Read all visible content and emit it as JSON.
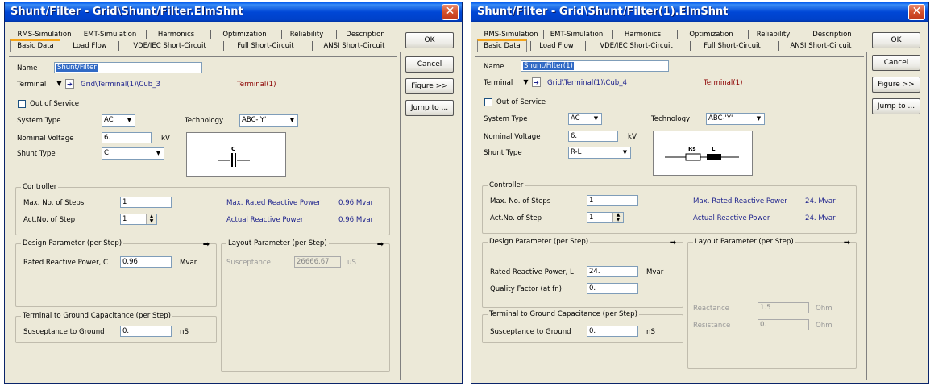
{
  "buttons": {
    "ok": "OK",
    "cancel": "Cancel",
    "figure": "Figure >>",
    "jump": "Jump to ..."
  },
  "tabs_row1": [
    "RMS-Simulation",
    "EMT-Simulation",
    "Harmonics",
    "Optimization",
    "Reliability",
    "Description"
  ],
  "tabs_row2": [
    "Basic Data",
    "Load Flow",
    "VDE/IEC Short-Circuit",
    "Full Short-Circuit",
    "ANSI Short-Circuit"
  ],
  "labels": {
    "name": "Name",
    "terminal": "Terminal",
    "out_of_service": "Out of Service",
    "system_type": "System Type",
    "technology": "Technology",
    "nominal_voltage": "Nominal Voltage",
    "kv": "kV",
    "shunt_type": "Shunt Type",
    "controller": "Controller",
    "max_steps": "Max. No. of Steps",
    "act_step": "Act.No. of Step",
    "max_rated_q": "Max. Rated Reactive Power",
    "actual_q": "Actual Reactive Power",
    "design": "Design Parameter (per Step)",
    "layout": "Layout Parameter (per Step)",
    "mvar": "Mvar",
    "t2g": "Terminal to Ground Capacitance (per Step)",
    "susc_ground": "Susceptance to Ground",
    "ns": "nS",
    "susceptance": "Susceptance",
    "us": "uS",
    "quality": "Quality Factor (at fn)",
    "reactance": "Reactance",
    "resistance": "Resistance",
    "ohm": "Ohm"
  },
  "left": {
    "title": "Shunt/Filter - Grid\\Shunt/Filter.ElmShnt",
    "name": "Shunt/Filter",
    "terminal_path": "Grid\\Terminal(1)\\Cub_3",
    "terminal_ref": "Terminal(1)",
    "system_type": "AC",
    "technology": "ABC-'Y'",
    "nominal_voltage": "6.",
    "shunt_type": "C",
    "diagram_label": "C",
    "max_steps": "1",
    "act_step": "1",
    "max_rated_q_value": "0.96 Mvar",
    "actual_q_value": "0.96 Mvar",
    "rated_label": "Rated Reactive Power, C",
    "rated_value": "0.96",
    "susc_ground_value": "0.",
    "susceptance_value": "26666.67"
  },
  "right": {
    "title": "Shunt/Filter - Grid\\Shunt/Filter(1).ElmShnt",
    "name": "Shunt/Filter(1)",
    "terminal_path": "Grid\\Terminal(1)\\Cub_4",
    "terminal_ref": "Terminal(1)",
    "system_type": "AC",
    "technology": "ABC-'Y'",
    "nominal_voltage": "6.",
    "shunt_type": "R-L",
    "diagram_label_r": "Rs",
    "diagram_label_l": "L",
    "max_steps": "1",
    "act_step": "1",
    "max_rated_q_value": "24. Mvar",
    "actual_q_value": "24. Mvar",
    "rated_label": "Rated Reactive Power, L",
    "rated_value": "24.",
    "quality_value": "0.",
    "susc_ground_value": "0.",
    "reactance_value": "1.5",
    "resistance_value": "0."
  }
}
